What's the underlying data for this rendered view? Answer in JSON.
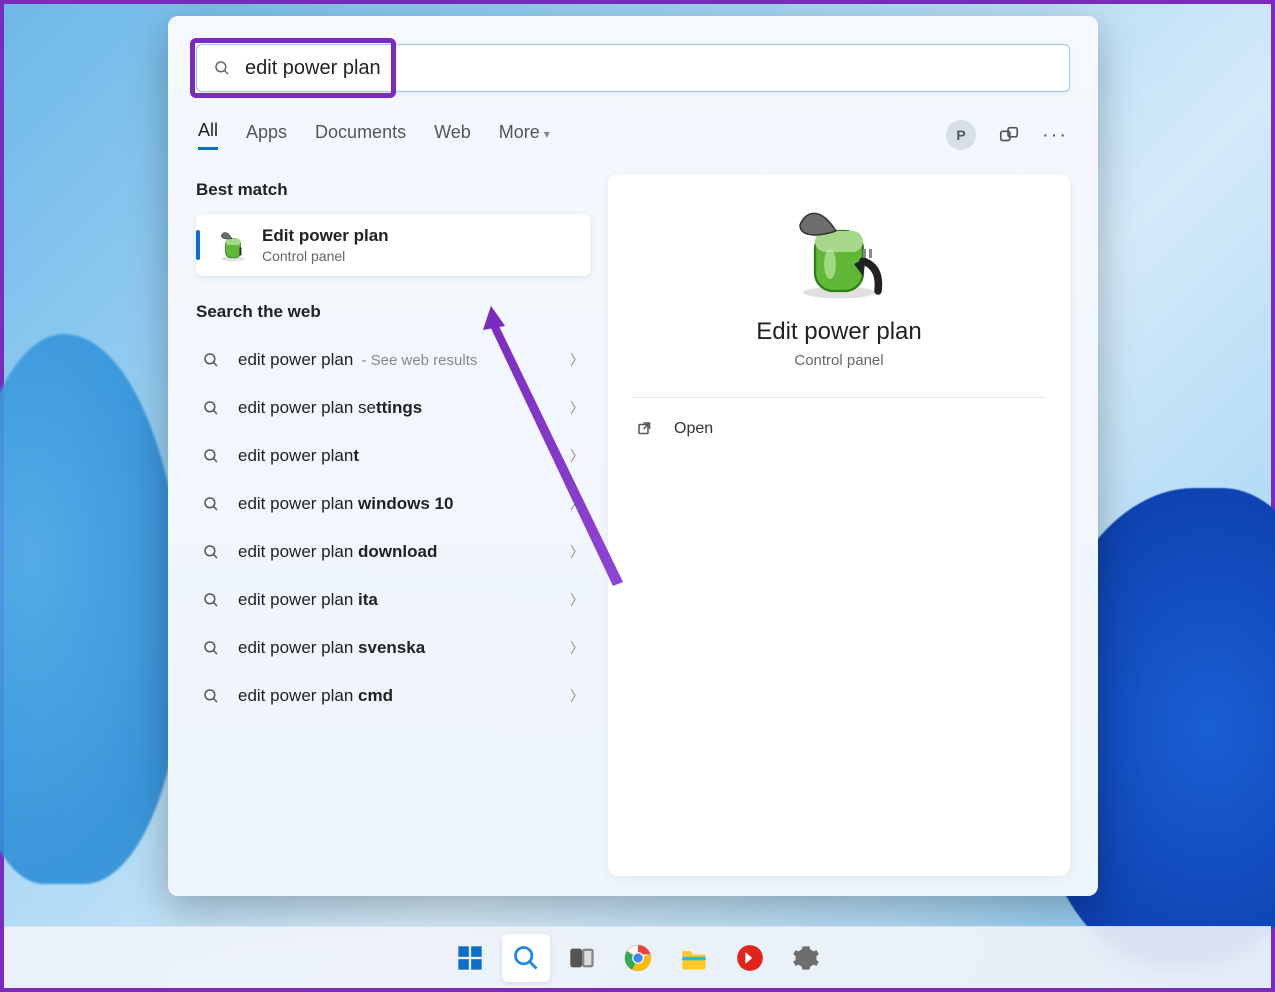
{
  "search": {
    "query": "edit power plan"
  },
  "tabs": {
    "all": "All",
    "apps": "Apps",
    "documents": "Documents",
    "web": "Web",
    "more": "More"
  },
  "user_initial": "P",
  "sections": {
    "best_match": "Best match",
    "search_web": "Search the web"
  },
  "best_match": {
    "title": "Edit power plan",
    "subtitle": "Control panel"
  },
  "web_results": [
    {
      "prefix": "edit power plan",
      "bold": "",
      "hint": "See web results"
    },
    {
      "prefix": "edit power plan se",
      "bold": "ttings",
      "hint": ""
    },
    {
      "prefix": "edit power plan",
      "bold": "t",
      "hint": ""
    },
    {
      "prefix": "edit power plan ",
      "bold": "windows 10",
      "hint": ""
    },
    {
      "prefix": "edit power plan ",
      "bold": "download",
      "hint": ""
    },
    {
      "prefix": "edit power plan ",
      "bold": "ita",
      "hint": ""
    },
    {
      "prefix": "edit power plan ",
      "bold": "svenska",
      "hint": ""
    },
    {
      "prefix": "edit power plan ",
      "bold": "cmd",
      "hint": ""
    }
  ],
  "detail": {
    "title": "Edit power plan",
    "subtitle": "Control panel",
    "open": "Open"
  },
  "taskbar": {
    "items": [
      "start",
      "search",
      "task-view",
      "chrome",
      "file-explorer",
      "anydesk",
      "settings"
    ]
  }
}
